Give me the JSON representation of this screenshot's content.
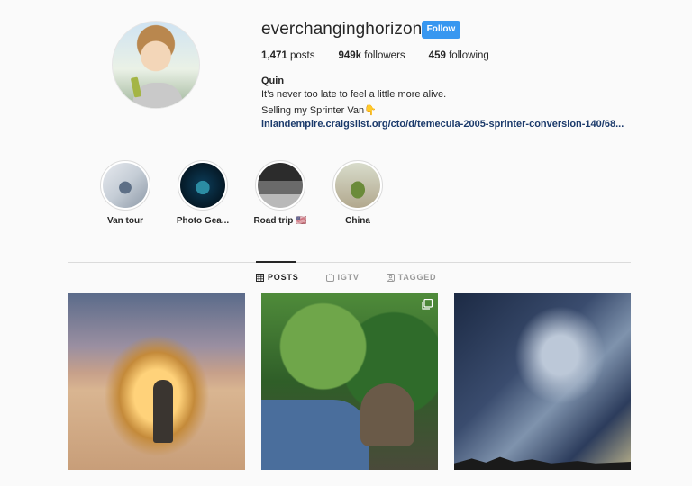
{
  "profile": {
    "username": "everchanginghorizon",
    "follow_label": "Follow",
    "stats": {
      "posts_count": "1,471",
      "posts_label": "posts",
      "followers_count": "949k",
      "followers_label": "followers",
      "following_count": "459",
      "following_label": "following"
    },
    "full_name": "Quin",
    "bio_line1": "It’s never too late to feel a little more alive.",
    "bio_line2": "Selling my Sprinter Van👇",
    "link": "inlandempire.craigslist.org/cto/d/temecula-2005-sprinter-conversion-140/68..."
  },
  "highlights": [
    {
      "label": "Van tour"
    },
    {
      "label": "Photo Gea..."
    },
    {
      "label": "Road trip 🇺🇸"
    },
    {
      "label": "China"
    }
  ],
  "tabs": [
    {
      "label": "POSTS",
      "icon": "grid-icon",
      "active": true
    },
    {
      "label": "IGTV",
      "icon": "igtv-icon",
      "active": false
    },
    {
      "label": "TAGGED",
      "icon": "tag-icon",
      "active": false
    }
  ],
  "colors": {
    "follow_button": "#3897f0",
    "link": "#1b3a6b",
    "background": "#fafafa"
  },
  "posts": [
    {
      "icon": ""
    },
    {
      "icon": "multiple-images-icon"
    },
    {
      "icon": ""
    }
  ]
}
